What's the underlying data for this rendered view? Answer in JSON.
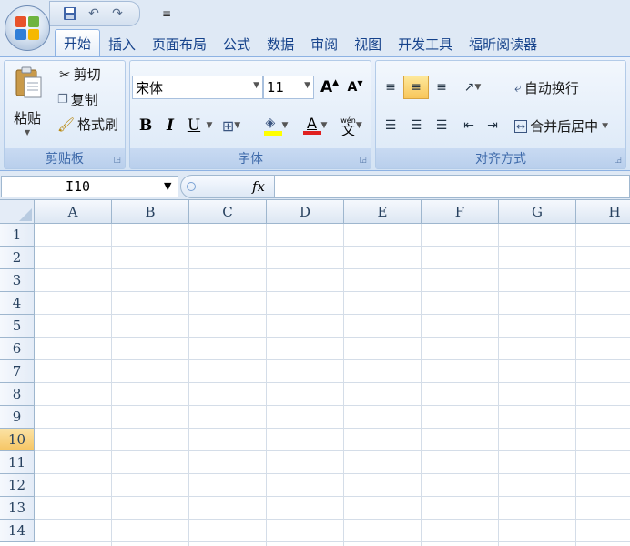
{
  "tabs": [
    "开始",
    "插入",
    "页面布局",
    "公式",
    "数据",
    "审阅",
    "视图",
    "开发工具",
    "福昕阅读器"
  ],
  "active_tab": 0,
  "clipboard": {
    "paste": "粘贴",
    "cut": "剪切",
    "copy": "复制",
    "format_painter": "格式刷",
    "label": "剪贴板"
  },
  "font": {
    "name": "宋体",
    "size": "11",
    "bold": "B",
    "italic": "I",
    "underline": "U",
    "font_color_letter": "A",
    "label": "字体"
  },
  "alignment": {
    "wrap_text": "自动换行",
    "merge_center": "合并后居中",
    "label": "对齐方式"
  },
  "formula_bar": {
    "name_box": "I10",
    "fx": "fx",
    "value": ""
  },
  "grid": {
    "columns": [
      "A",
      "B",
      "C",
      "D",
      "E",
      "F",
      "G",
      "H"
    ],
    "rows": [
      "1",
      "2",
      "3",
      "4",
      "5",
      "6",
      "7",
      "8",
      "9",
      "10",
      "11",
      "12",
      "13",
      "14"
    ],
    "active_row": "10",
    "active_cell": "I10"
  },
  "colors": {
    "ribbon_blue": "#15428b",
    "highlight_yellow": "#f8c65a",
    "font_red": "#e02020",
    "fill_yellow": "#ffff00"
  }
}
